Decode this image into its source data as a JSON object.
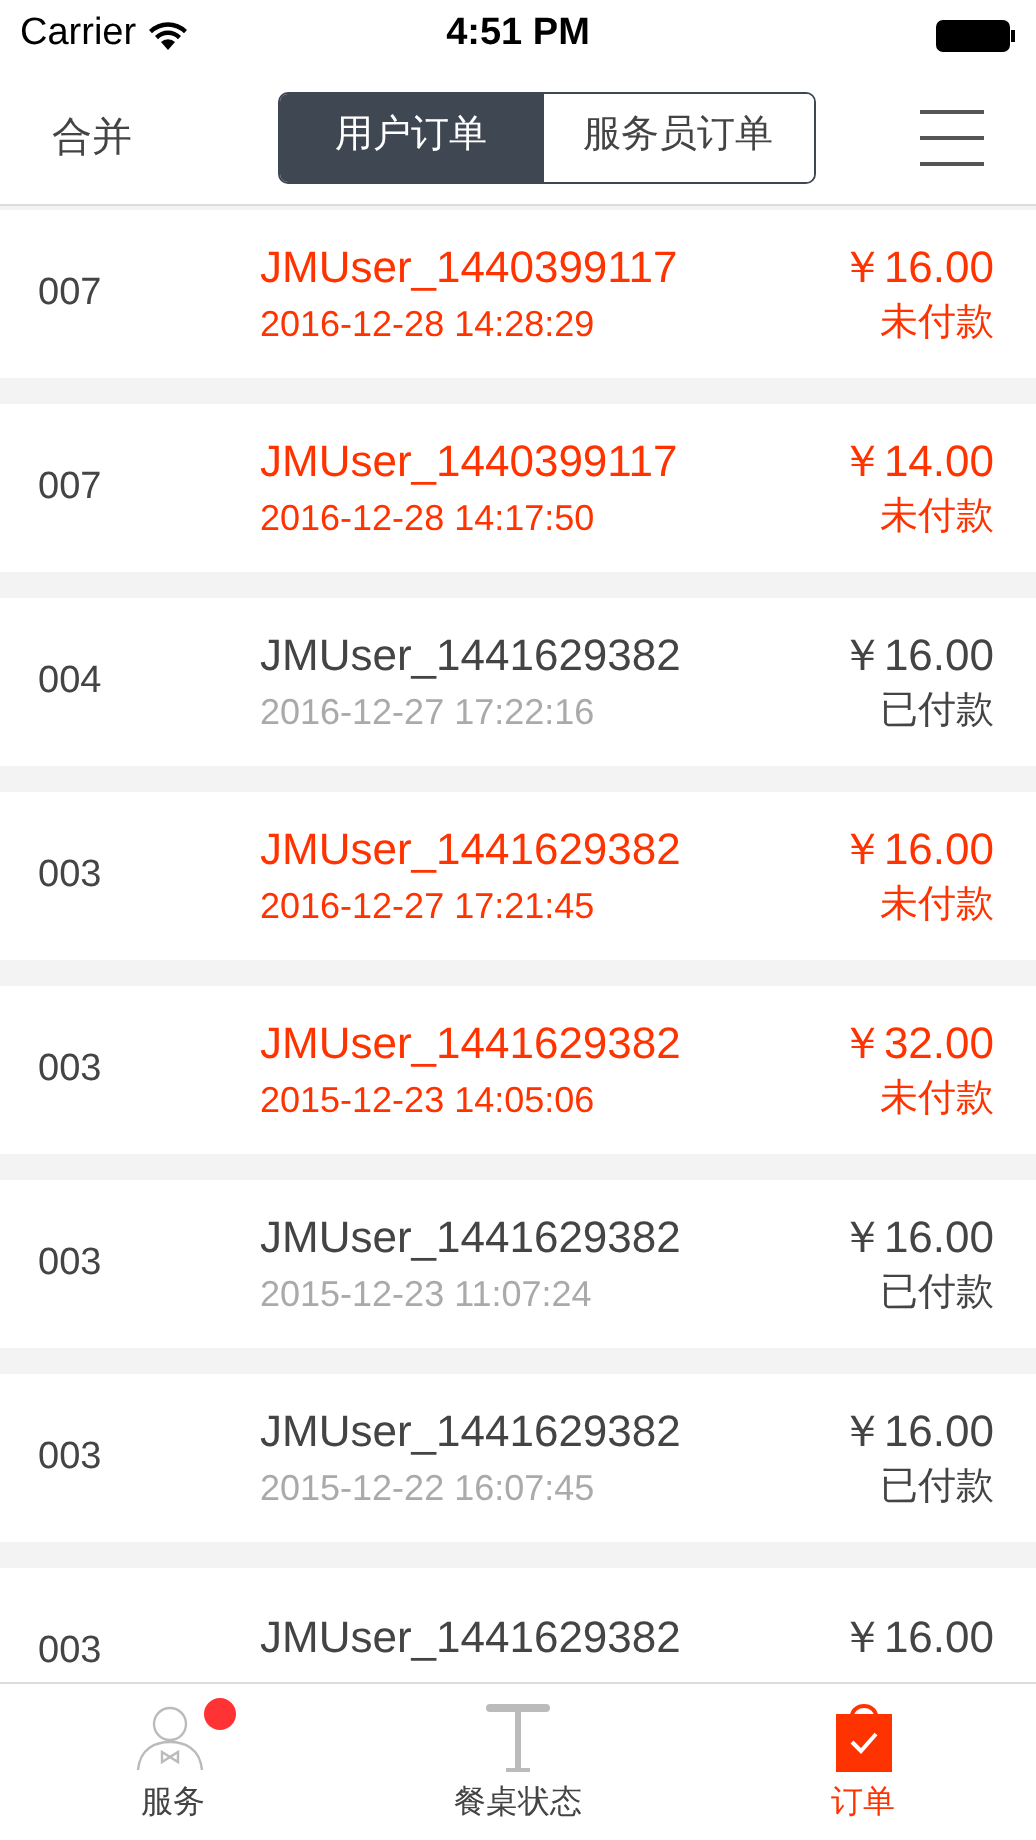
{
  "status_bar": {
    "carrier": "Carrier",
    "time": "4:51 PM"
  },
  "nav": {
    "left": "合并",
    "segments": [
      {
        "label": "用户订单",
        "selected": true
      },
      {
        "label": "服务员订单",
        "selected": false
      }
    ]
  },
  "orders": [
    {
      "table": "007",
      "user": "JMUser_1440399117",
      "time": "2016-12-28 14:28:29",
      "amount": "￥16.00",
      "status": "未付款",
      "paid": false
    },
    {
      "table": "007",
      "user": "JMUser_1440399117",
      "time": "2016-12-28 14:17:50",
      "amount": "￥14.00",
      "status": "未付款",
      "paid": false
    },
    {
      "table": "004",
      "user": "JMUser_1441629382",
      "time": "2016-12-27 17:22:16",
      "amount": "￥16.00",
      "status": "已付款",
      "paid": true
    },
    {
      "table": "003",
      "user": "JMUser_1441629382",
      "time": "2016-12-27 17:21:45",
      "amount": "￥16.00",
      "status": "未付款",
      "paid": false
    },
    {
      "table": "003",
      "user": "JMUser_1441629382",
      "time": "2015-12-23 14:05:06",
      "amount": "￥32.00",
      "status": "未付款",
      "paid": false
    },
    {
      "table": "003",
      "user": "JMUser_1441629382",
      "time": "2015-12-23 11:07:24",
      "amount": "￥16.00",
      "status": "已付款",
      "paid": true
    },
    {
      "table": "003",
      "user": "JMUser_1441629382",
      "time": "2015-12-22 16:07:45",
      "amount": "￥16.00",
      "status": "已付款",
      "paid": true
    },
    {
      "table": "003",
      "user": "JMUser_1441629382",
      "amount": "￥16.00",
      "paid": true
    }
  ],
  "tab_bar": [
    {
      "label": "服务",
      "kind": "waiter",
      "selected": false,
      "badge": true
    },
    {
      "label": "餐桌状态",
      "kind": "table",
      "selected": false,
      "badge": false
    },
    {
      "label": "订单",
      "kind": "bag",
      "selected": true,
      "badge": false
    }
  ]
}
